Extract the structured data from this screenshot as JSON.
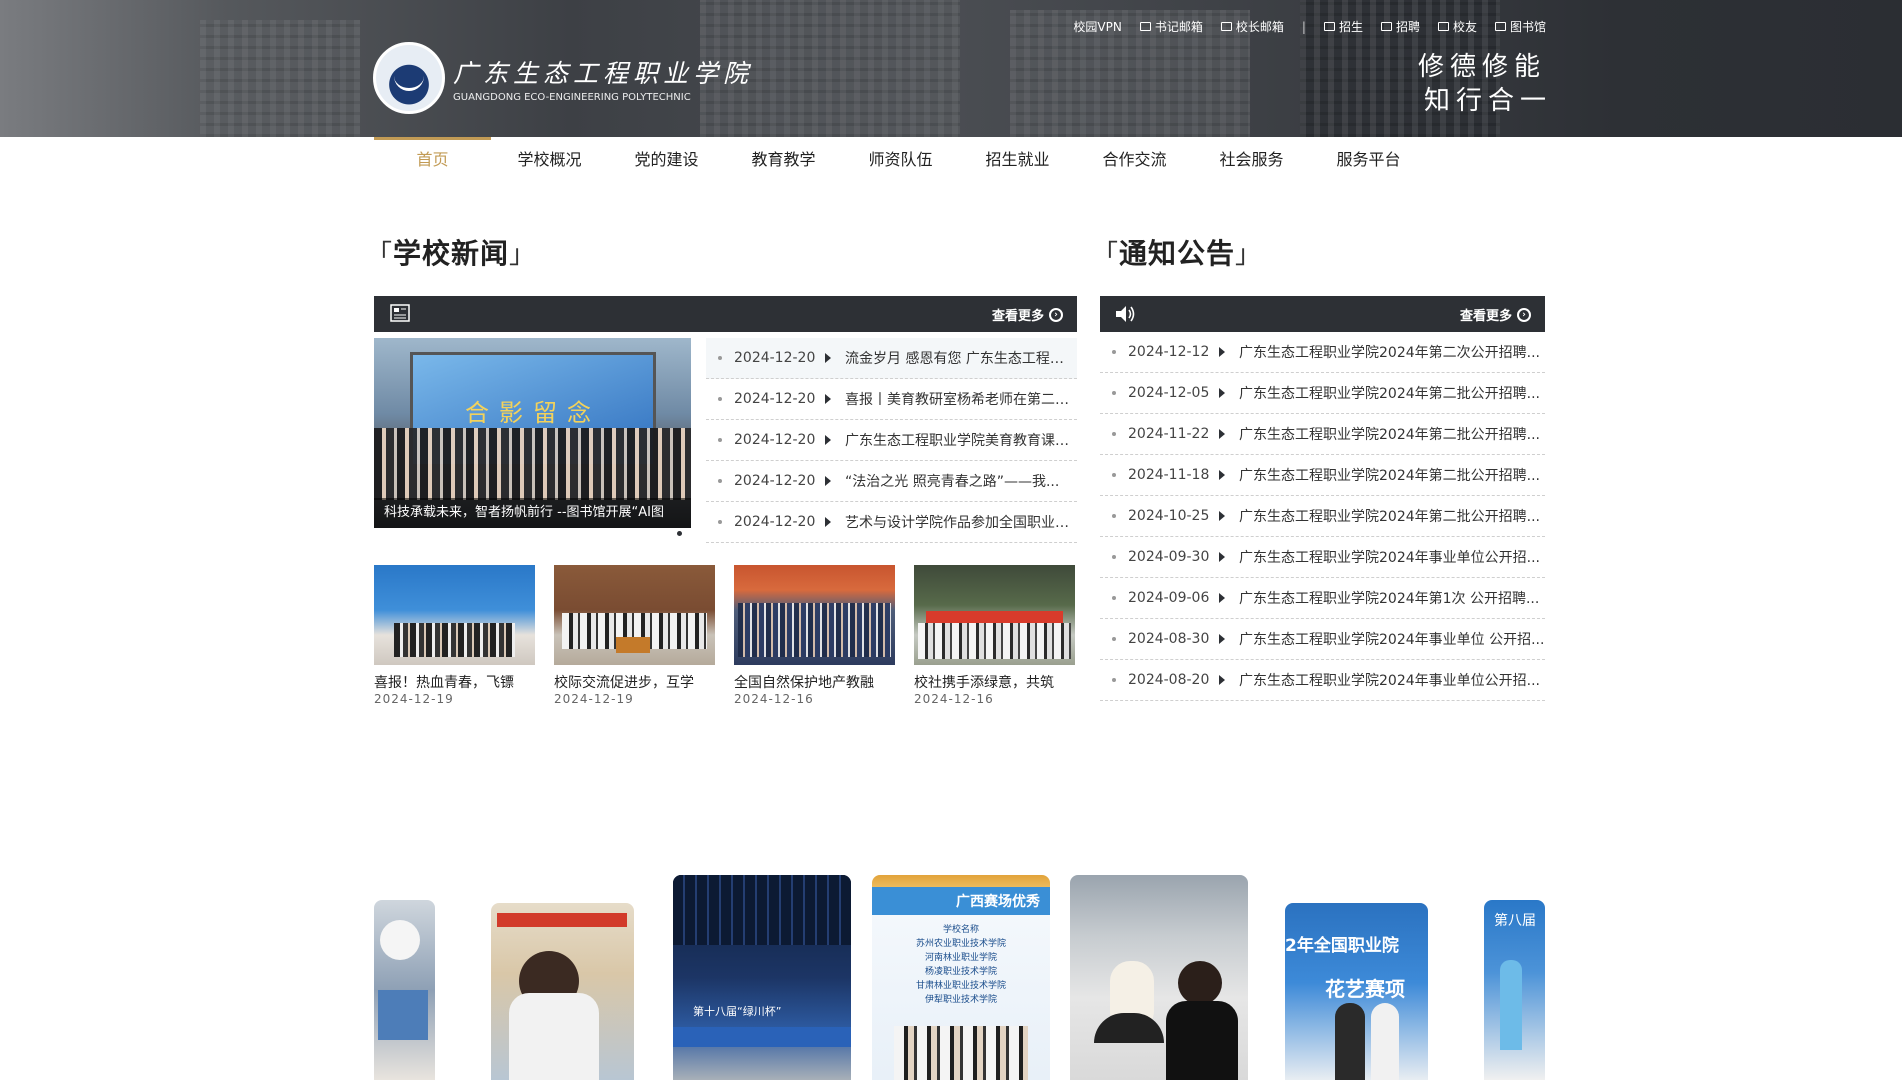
{
  "header": {
    "logo_cn": "广东生态工程职业学院",
    "logo_en": "GUANGDONG ECO-ENGINEERING POLYTECHNIC",
    "motto_line1": "修德修能",
    "motto_line2": "知行合一",
    "toplinks": [
      {
        "label": "校园VPN"
      },
      {
        "label": "书记邮箱",
        "icon": "mail-icon"
      },
      {
        "label": "校长邮箱",
        "icon": "mail-icon"
      },
      {
        "label": "招生",
        "icon": "enroll-icon"
      },
      {
        "label": "招聘",
        "icon": "recruit-icon"
      },
      {
        "label": "校友",
        "icon": "alumni-icon"
      },
      {
        "label": "图书馆",
        "icon": "book-icon"
      }
    ],
    "separator": "|"
  },
  "nav": {
    "items": [
      "首页",
      "学校概况",
      "党的建设",
      "教育教学",
      "师资队伍",
      "招生就业",
      "合作交流",
      "社会服务",
      "服务平台"
    ]
  },
  "news": {
    "title": "学校新闻",
    "more": "查看更多",
    "feature_screen_text": "合影留念",
    "feature_caption": "科技承载未来，智者扬帆前行 --图书馆开展“AI图",
    "items": [
      {
        "date": "2024-12-20",
        "title": "流金岁月 感恩有您 广东生态工程职..."
      },
      {
        "date": "2024-12-20",
        "title": "喜报丨美育教研室杨希老师在第二届..."
      },
      {
        "date": "2024-12-20",
        "title": "广东生态工程职业学院美育教育课程..."
      },
      {
        "date": "2024-12-20",
        "title": "“法治之光 照亮青春之路”——我..."
      },
      {
        "date": "2024-12-20",
        "title": "艺术与设计学院作品参加全国职业院..."
      }
    ],
    "thumbs": [
      {
        "title": "喜报！热血青春，飞镖",
        "date": "2024-12-19"
      },
      {
        "title": "校际交流促进步，互学",
        "date": "2024-12-19"
      },
      {
        "title": "全国自然保护地产教融",
        "date": "2024-12-16"
      },
      {
        "title": "校社携手添绿意，共筑",
        "date": "2024-12-16"
      }
    ]
  },
  "notice": {
    "title": "通知公告",
    "more": "查看更多",
    "items": [
      {
        "date": "2024-12-12",
        "title": "广东生态工程职业学院2024年第二次公开招聘..."
      },
      {
        "date": "2024-12-05",
        "title": "广东生态工程职业学院2024年第二批公开招聘..."
      },
      {
        "date": "2024-11-22",
        "title": "广东生态工程职业学院2024年第二批公开招聘..."
      },
      {
        "date": "2024-11-18",
        "title": "广东生态工程职业学院2024年第二批公开招聘..."
      },
      {
        "date": "2024-10-25",
        "title": "广东生态工程职业学院2024年第二批公开招聘..."
      },
      {
        "date": "2024-09-30",
        "title": "广东生态工程职业学院2024年事业单位公开招..."
      },
      {
        "date": "2024-09-06",
        "title": "广东生态工程职业学院2024年第1次 公开招聘..."
      },
      {
        "date": "2024-08-30",
        "title": "广东生态工程职业学院2024年事业单位 公开招..."
      },
      {
        "date": "2024-08-20",
        "title": "广东生态工程职业学院2024年事业单位公开招..."
      }
    ]
  },
  "carousel": {
    "slide2_text": "第十八届“绿川杯”",
    "slide3_heading": "广西赛场优秀",
    "slide3_col": "学校名称",
    "slide3_rows": [
      "苏州农业职业技术学院",
      "河南林业职业学院",
      "杨凌职业技术学院",
      "甘肃林业职业技术学院",
      "伊犁职业技术学院"
    ],
    "slide5_text": "2年全国职业院",
    "slide5_sub": "花艺赛项",
    "slide6_text": "第八届"
  }
}
